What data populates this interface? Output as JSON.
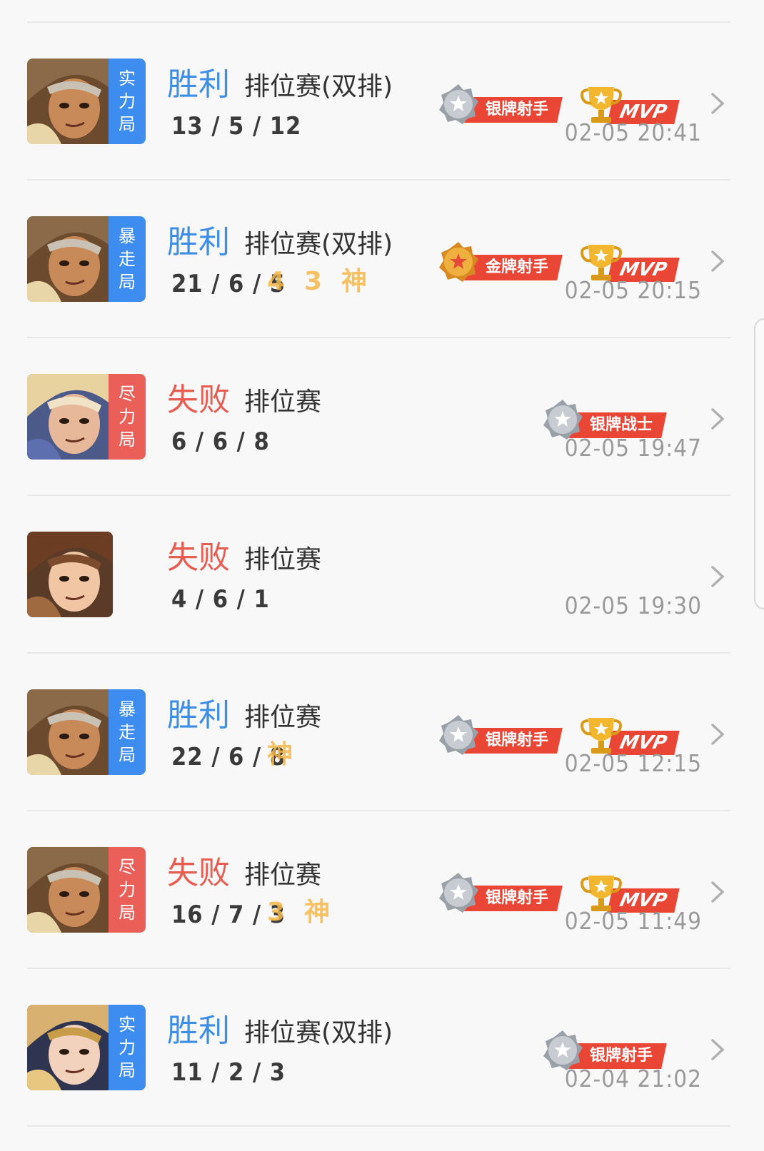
{
  "matches": [
    {
      "hero": "warrior-hero",
      "tag": "实力局",
      "tag_color": "#3d8df0",
      "result": "胜利",
      "result_type": "win",
      "mode": "排位赛(双排)",
      "kda": "13 / 5 / 12",
      "streaks": [],
      "badge": {
        "kind": "silver",
        "label": "银牌射手"
      },
      "mvp": true,
      "mvp_label": "MVP",
      "time": "02-05 20:41"
    },
    {
      "hero": "warrior-hero",
      "tag": "暴走局",
      "tag_color": "#3d8df0",
      "result": "胜利",
      "result_type": "win",
      "mode": "排位赛(双排)",
      "kda": "21 / 6 / 5",
      "streaks": [
        "4",
        "3",
        "神"
      ],
      "badge": {
        "kind": "gold",
        "label": "金牌射手"
      },
      "mvp": true,
      "mvp_label": "MVP",
      "time": "02-05 20:15"
    },
    {
      "hero": "blonde-hero",
      "tag": "尽力局",
      "tag_color": "#ea6058",
      "result": "失败",
      "result_type": "lose",
      "mode": "排位赛",
      "kda": "6 / 6 / 8",
      "streaks": [],
      "badge": {
        "kind": "silver",
        "label": "银牌战士"
      },
      "mvp": false,
      "time": "02-05 19:47"
    },
    {
      "hero": "boy-hero",
      "tag": "",
      "tag_color": "",
      "result": "失败",
      "result_type": "lose",
      "mode": "排位赛",
      "kda": "4 / 6 / 1",
      "streaks": [],
      "badge": null,
      "mvp": false,
      "time": "02-05 19:30"
    },
    {
      "hero": "warrior-hero",
      "tag": "暴走局",
      "tag_color": "#3d8df0",
      "result": "胜利",
      "result_type": "win",
      "mode": "排位赛",
      "kda": "22 / 6 / 8",
      "streaks": [
        "神"
      ],
      "badge": {
        "kind": "silver",
        "label": "银牌射手"
      },
      "mvp": true,
      "mvp_label": "MVP",
      "time": "02-05 12:15"
    },
    {
      "hero": "warrior-hero",
      "tag": "尽力局",
      "tag_color": "#ea6058",
      "result": "失败",
      "result_type": "lose",
      "mode": "排位赛",
      "kda": "16 / 7 / 3",
      "streaks": [
        "3",
        "神"
      ],
      "badge": {
        "kind": "silver",
        "label": "银牌射手"
      },
      "mvp": true,
      "mvp_label": "MVP",
      "time": "02-05 11:49"
    },
    {
      "hero": "lady-hero",
      "tag": "实力局",
      "tag_color": "#3d8df0",
      "result": "胜利",
      "result_type": "win",
      "mode": "排位赛(双排)",
      "kda": "11 / 2 / 3",
      "streaks": [],
      "badge": {
        "kind": "silver",
        "label": "银牌射手"
      },
      "mvp": false,
      "time": "02-04 21:02"
    }
  ],
  "icons": {
    "chevron": "chevron-right-icon",
    "medal": "medal-icon",
    "trophy": "trophy-icon"
  }
}
